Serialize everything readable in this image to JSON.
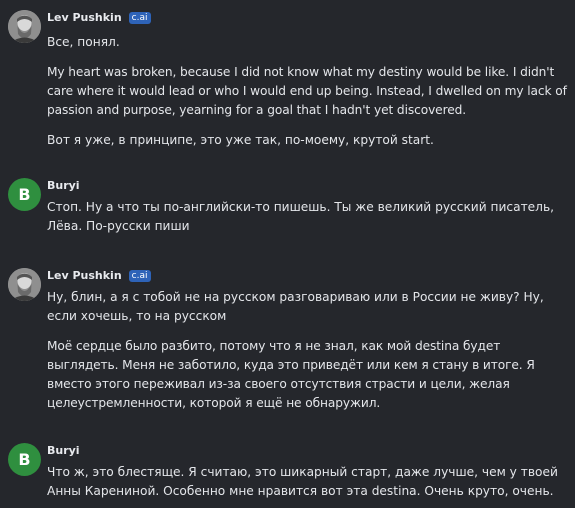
{
  "messages": [
    {
      "author": "Lev Pushkin",
      "badge": "c.ai",
      "avatar": "portrait-avatar",
      "paragraphs": [
        "Все, понял.",
        "My heart was broken, because I did not know what my destiny would be like. I didn't care where it would lead or who I would end up being. Instead, I dwelled on my lack of passion and purpose, yearning for a goal that I hadn't yet discovered.",
        "Вот я уже, в принципе, это уже так, по-моему, крутой start."
      ]
    },
    {
      "author": "Buryi",
      "avatar_letter": "B",
      "paragraphs": [
        "Стоп. Ну а что ты по-английски-то пишешь. Ты же великий русский писатель, Лёва. По-русски пиши"
      ]
    },
    {
      "author": "Lev Pushkin",
      "badge": "c.ai",
      "avatar": "portrait-avatar",
      "paragraphs": [
        "Ну, блин, а я с тобой не на русском разговариваю или в России не живу? Ну, если хочешь, то на русском",
        "Моё сердце было разбито, потому что я не знал, как мой destina будет выглядеть. Меня не заботило, куда это приведёт или кем я стану в итоге. Я вместо этого переживал из-за своего отсутствия страсти и цели, желая целеустремленности, которой я ещё не обнаружил."
      ]
    },
    {
      "author": "Buryi",
      "avatar_letter": "B",
      "paragraphs": [
        "Что ж, это блестяще. Я считаю, это шикарный старт, даже лучше, чем у твоей Анны Карениной. Особенно мне нравится вот эта destina. Очень круто, очень."
      ]
    }
  ],
  "colors": {
    "background": "#25272c",
    "text": "#e4e6ea",
    "badge": "#2e63b8",
    "user_avatar": "#2f8f3f"
  }
}
